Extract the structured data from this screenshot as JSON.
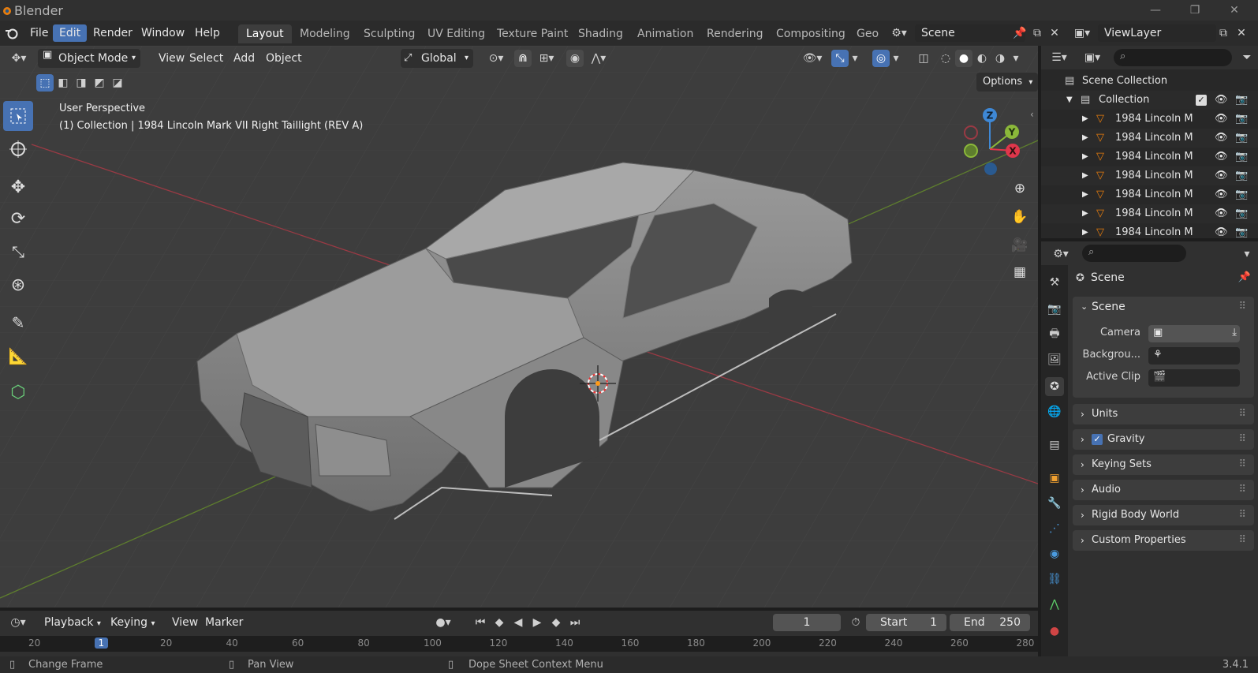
{
  "app": {
    "title": "Blender",
    "version": "3.4.1"
  },
  "menu": [
    "File",
    "Edit",
    "Render",
    "Window",
    "Help"
  ],
  "workspaces": [
    "Layout",
    "Modeling",
    "Sculpting",
    "UV Editing",
    "Texture Paint",
    "Shading",
    "Animation",
    "Rendering",
    "Compositing",
    "Geo"
  ],
  "scene_field": "Scene",
  "viewlayer_field": "ViewLayer",
  "viewport": {
    "mode": "Object Mode",
    "menus": [
      "View",
      "Select",
      "Add",
      "Object"
    ],
    "transform_orientation": "Global",
    "options_label": "Options",
    "overlay_title": "User Perspective",
    "overlay_subtitle": "(1) Collection | 1984 Lincoln Mark VII Right Taillight (REV A)",
    "gizmo_axes": {
      "z": "Z",
      "y": "Y",
      "x": "X"
    }
  },
  "outliner": {
    "root": "Scene Collection",
    "collection": "Collection",
    "items": [
      "1984 Lincoln M",
      "1984 Lincoln M",
      "1984 Lincoln M",
      "1984 Lincoln M",
      "1984 Lincoln M",
      "1984 Lincoln M",
      "1984 Lincoln M"
    ]
  },
  "properties": {
    "header": "Scene",
    "panel_title": "Scene",
    "camera_label": "Camera",
    "background_label": "Backgrou...",
    "active_clip_label": "Active Clip",
    "subpanels": [
      "Units",
      "Gravity",
      "Keying Sets",
      "Audio",
      "Rigid Body World",
      "Custom Properties"
    ],
    "gravity_checked": true
  },
  "timeline": {
    "menus": [
      "Playback",
      "Keying",
      "View",
      "Marker"
    ],
    "current_frame": "1",
    "start_label": "Start",
    "start_value": "1",
    "end_label": "End",
    "end_value": "250",
    "ruler": [
      "20",
      "1",
      "20",
      "40",
      "60",
      "80",
      "100",
      "120",
      "140",
      "160",
      "180",
      "200",
      "220",
      "240",
      "260",
      "280"
    ]
  },
  "status": {
    "left": "Change Frame",
    "middle": "Pan View",
    "right": "Dope Sheet Context Menu"
  },
  "colors": {
    "accent": "#4772b3",
    "axis_x": "#e0364b",
    "axis_y": "#8bb83a",
    "axis_z": "#3e88d6"
  }
}
